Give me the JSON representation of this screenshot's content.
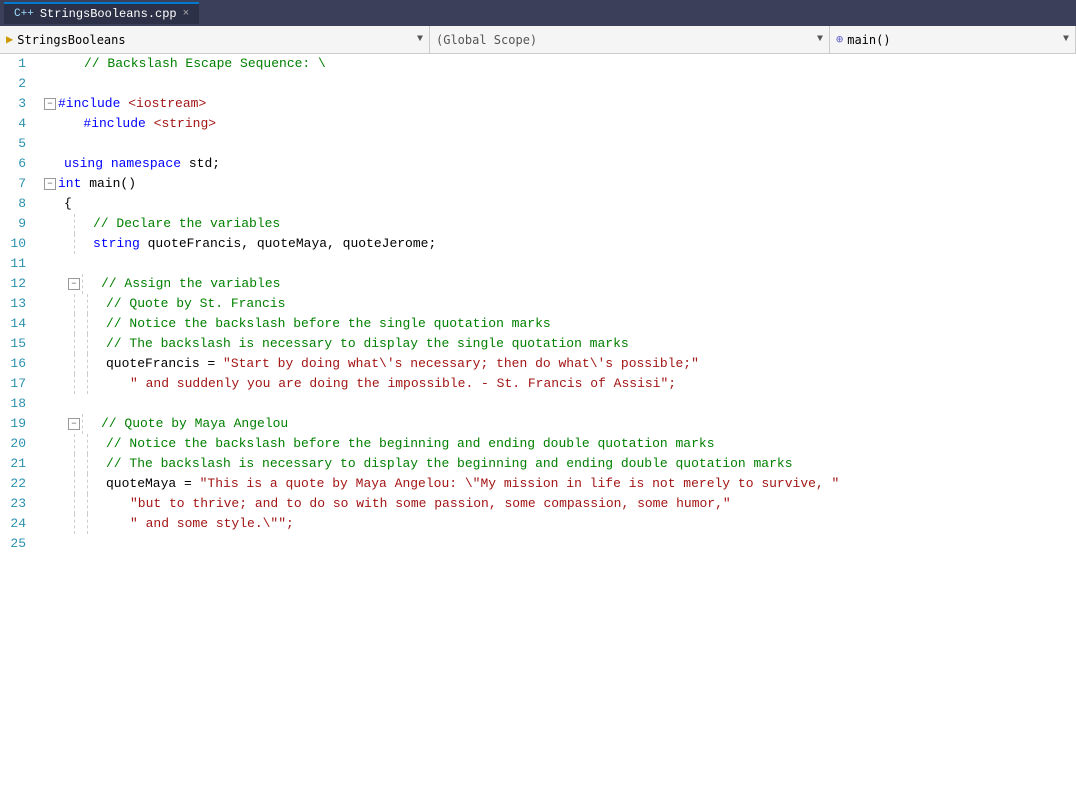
{
  "titlebar": {
    "tab_label": "StringsBooleans.cpp",
    "tab_close": "×"
  },
  "toolbar": {
    "project_icon": "▶",
    "project_name": "StringsBooleans",
    "dropdown_arrow1": "▼",
    "scope_label": "(Global Scope)",
    "dropdown_arrow2": "▼",
    "func_icon": "⊕",
    "func_name": "main()",
    "dropdown_arrow3": "▼"
  },
  "lines": [
    {
      "num": 1,
      "indent": 0,
      "prefix": "",
      "collapse": "",
      "content": "    // Backslash Escape Sequence: \\",
      "type": "comment"
    },
    {
      "num": 2,
      "indent": 0,
      "prefix": "",
      "collapse": "",
      "content": "",
      "type": "empty"
    },
    {
      "num": 3,
      "indent": 0,
      "prefix": "⊟",
      "collapse": "minus",
      "content": "#include <iostream>",
      "type": "include"
    },
    {
      "num": 4,
      "indent": 0,
      "prefix": "",
      "collapse": "",
      "content": "    #include <string>",
      "type": "include"
    },
    {
      "num": 5,
      "indent": 0,
      "prefix": "",
      "collapse": "",
      "content": "",
      "type": "empty"
    },
    {
      "num": 6,
      "indent": 0,
      "prefix": "",
      "collapse": "",
      "content": "    using namespace std;",
      "type": "using"
    },
    {
      "num": 7,
      "indent": 0,
      "prefix": "⊟",
      "collapse": "minus",
      "content": "int main()",
      "type": "func"
    },
    {
      "num": 8,
      "indent": 0,
      "prefix": "",
      "collapse": "",
      "content": "    {",
      "type": "brace"
    },
    {
      "num": 9,
      "indent": 2,
      "prefix": "",
      "collapse": "",
      "content": "    // Declare the variables",
      "type": "comment"
    },
    {
      "num": 10,
      "indent": 2,
      "prefix": "",
      "collapse": "",
      "content": "    string quoteFrancis, quoteMaya, quoteJerome;",
      "type": "decl"
    },
    {
      "num": 11,
      "indent": 0,
      "prefix": "",
      "collapse": "",
      "content": "",
      "type": "empty"
    },
    {
      "num": 12,
      "indent": 1,
      "prefix": "⊟",
      "collapse": "minus",
      "content": "    // Assign the variables",
      "type": "comment"
    },
    {
      "num": 13,
      "indent": 2,
      "prefix": "",
      "collapse": "",
      "content": "    // Quote by St. Francis",
      "type": "comment"
    },
    {
      "num": 14,
      "indent": 2,
      "prefix": "",
      "collapse": "",
      "content": "    // Notice the backslash before the single quotation marks",
      "type": "comment"
    },
    {
      "num": 15,
      "indent": 2,
      "prefix": "",
      "collapse": "",
      "content": "    // The backslash is necessary to display the single quotation marks",
      "type": "comment"
    },
    {
      "num": 16,
      "indent": 2,
      "prefix": "",
      "collapse": "",
      "content": "    quoteFrancis = \"Start by doing what\\'s necessary; then do what\\'s possible;\"",
      "type": "assign"
    },
    {
      "num": 17,
      "indent": 3,
      "prefix": "",
      "collapse": "",
      "content": "         \" and suddenly you are doing the impossible. - St. Francis of Assisi\";",
      "type": "string_cont"
    },
    {
      "num": 18,
      "indent": 0,
      "prefix": "",
      "collapse": "",
      "content": "",
      "type": "empty"
    },
    {
      "num": 19,
      "indent": 1,
      "prefix": "⊟",
      "collapse": "minus",
      "content": "    // Quote by Maya Angelou",
      "type": "comment"
    },
    {
      "num": 20,
      "indent": 2,
      "prefix": "",
      "collapse": "",
      "content": "    // Notice the backslash before the beginning and ending double quotation marks",
      "type": "comment"
    },
    {
      "num": 21,
      "indent": 2,
      "prefix": "",
      "collapse": "",
      "content": "    // The backslash is necessary to display the beginning and ending double quotation marks",
      "type": "comment"
    },
    {
      "num": 22,
      "indent": 2,
      "prefix": "",
      "collapse": "",
      "content": "    quoteMaya = \"This is a quote by Maya Angelou: \\\"My mission in life is not merely to survive, \"",
      "type": "assign2"
    },
    {
      "num": 23,
      "indent": 3,
      "prefix": "",
      "collapse": "",
      "content": "         \"but to thrive; and to do so with some passion, some compassion, some humor,\"",
      "type": "string_cont"
    },
    {
      "num": 24,
      "indent": 3,
      "prefix": "",
      "collapse": "",
      "content": "         \" and some style.\\\"\";",
      "type": "string_cont"
    },
    {
      "num": 25,
      "indent": 0,
      "prefix": "",
      "collapse": "",
      "content": "",
      "type": "empty"
    }
  ],
  "colors": {
    "comment": "#008000",
    "keyword": "#0000ff",
    "string": "#a31515",
    "include_hash": "#0000ff",
    "include_lib": "#a31515",
    "type": "#0000ff",
    "normal": "#000000",
    "line_num": "#2b91af",
    "using": "#0000ff",
    "namespace": "#0000ff",
    "std": "#000000"
  }
}
